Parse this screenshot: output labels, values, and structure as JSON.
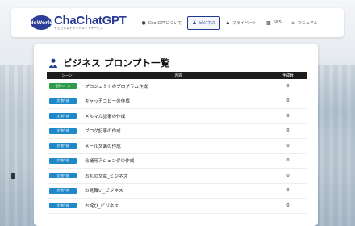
{
  "brand": {
    "badge": "NeWorld",
    "title": "ChaChatGPT",
    "subtitle": "もちもちなチャットＧＰＴサービス"
  },
  "nav": [
    {
      "label": "ChatGPTについて",
      "icon": "info-icon"
    },
    {
      "label": "ビジネス",
      "icon": "person-icon",
      "active": true
    },
    {
      "label": "プライベート",
      "icon": "person-icon"
    },
    {
      "label": "SNS",
      "icon": "chat-icon"
    },
    {
      "label": "マニュアル",
      "icon": "menu-icon"
    }
  ],
  "page": {
    "title": "ビジネス プロンプト一覧"
  },
  "table": {
    "headers": {
      "scene": "シーン",
      "content": "内容",
      "count": "生成数"
    },
    "rows": [
      {
        "tag": "便利ツール",
        "tag_color": "#2e9c4a",
        "label": "プロジェクトのプログラム作成",
        "count": "0"
      },
      {
        "tag": "文書作成",
        "tag_color": "#1e88c8",
        "label": "キャッチコピーの作成",
        "count": "0"
      },
      {
        "tag": "文書作成",
        "tag_color": "#1e88c8",
        "label": "メルマガ記事の作成",
        "count": "0"
      },
      {
        "tag": "文書作成",
        "tag_color": "#1e88c8",
        "label": "ブログ記事の作成",
        "count": "0"
      },
      {
        "tag": "文書作成",
        "tag_color": "#1e88c8",
        "label": "メール文面の作成",
        "count": "0"
      },
      {
        "tag": "文書作成",
        "tag_color": "#1e88c8",
        "label": "会議用アジェンダの作成",
        "count": "0"
      },
      {
        "tag": "文書作成",
        "tag_color": "#1e88c8",
        "label": "お礼の文章_ビジネス",
        "count": "0"
      },
      {
        "tag": "文書作成",
        "tag_color": "#1e88c8",
        "label": "お見舞い_ビジネス",
        "count": "0"
      },
      {
        "tag": "文書作成",
        "tag_color": "#1e88c8",
        "label": "お詫び_ビジネス",
        "count": "0"
      }
    ]
  }
}
